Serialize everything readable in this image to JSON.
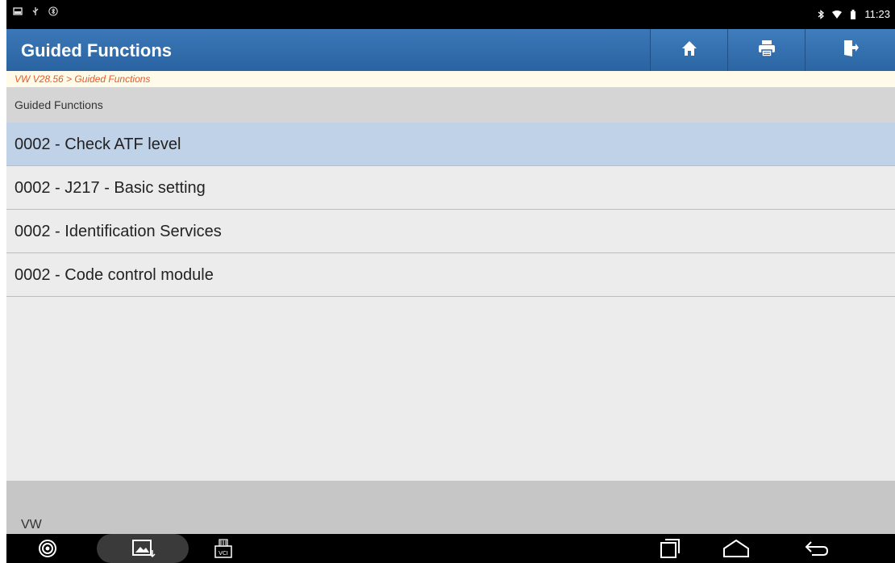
{
  "status_bar": {
    "time": "11:23"
  },
  "header": {
    "title": "Guided Functions",
    "buttons": [
      {
        "icon": "home-icon"
      },
      {
        "icon": "printer-icon"
      },
      {
        "icon": "exit-icon"
      }
    ]
  },
  "breadcrumb": "VW V28.56 > Guided Functions",
  "section_header": "Guided Functions",
  "list": {
    "items": [
      {
        "label": "0002 - Check ATF level",
        "selected": true
      },
      {
        "label": "0002 - J217 - Basic setting",
        "selected": false
      },
      {
        "label": "0002 - Identification Services",
        "selected": false
      },
      {
        "label": "0002 - Code control module",
        "selected": false
      }
    ]
  },
  "footer": {
    "brand": "VW"
  },
  "nav_bar": {
    "icons": [
      "browser-icon",
      "gallery-icon",
      "vci-icon",
      "recent-apps-icon",
      "home-nav-icon",
      "back-icon"
    ],
    "vci_label": "VCI"
  },
  "colors": {
    "accent": "#2e6aa8",
    "breadcrumb_text": "#e55a2b",
    "selected_row": "#c0d2e8"
  }
}
